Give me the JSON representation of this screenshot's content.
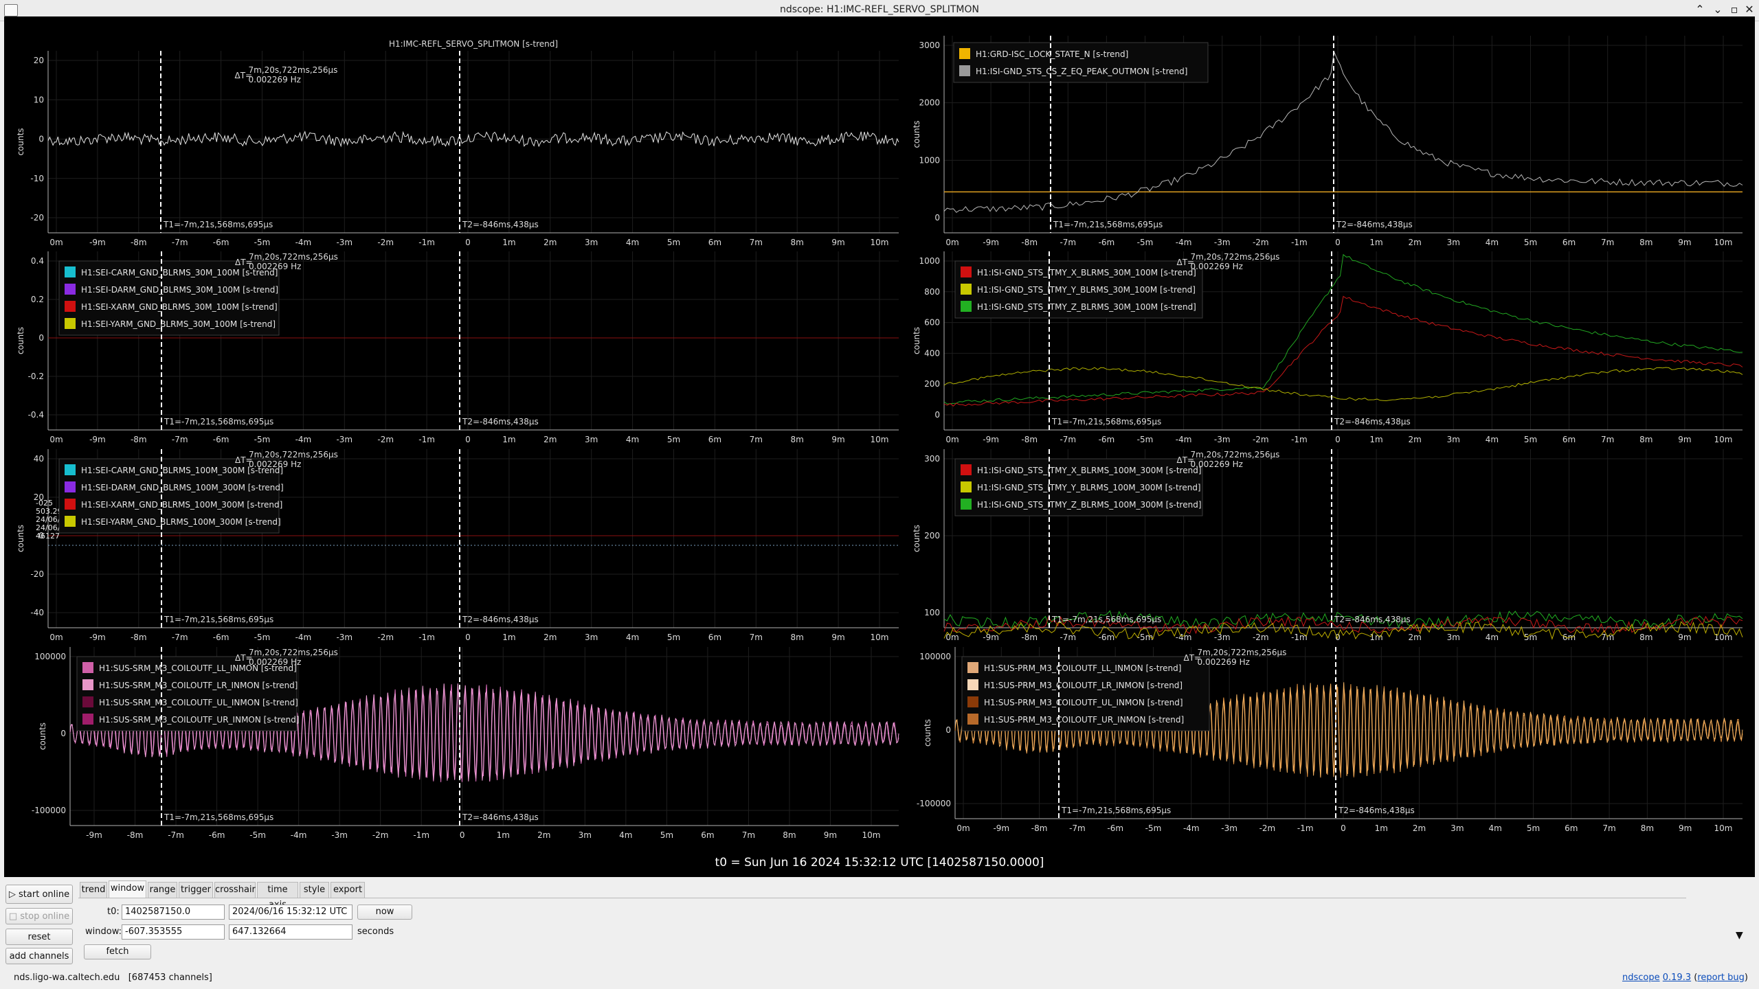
{
  "window": {
    "title": "ndscope: H1:IMC-REFL_SERVO_SPLITMON"
  },
  "t0_text": "t0 = Sun Jun 16 2024 15:32:12 UTC [1402587150.0000]",
  "colors": {
    "background": "#000000",
    "grid": "#1e1e1e",
    "axis": "#b4b4b4",
    "cursor": "#ffffff"
  },
  "cursor_readouts": {
    "t1_label": "T1=-7m,21s,568ms,695µs",
    "t2_label": "T2=-846ms,438µs",
    "delta_t_label": "ΔT=",
    "delta_t_value": "7m,20s,722ms,256µs",
    "delta_f_value": "0.002269 Hz"
  },
  "plots": [
    {
      "y_label": "counts",
      "title": "H1:IMC-REFL_SERVO_SPLITMON [s-trend]",
      "x_ticks": [
        "0m",
        "-9m",
        "-8m",
        "-7m",
        "-6m",
        "-5m",
        "-4m",
        "-3m",
        "-2m",
        "-1m",
        "0",
        "1m",
        "2m",
        "3m",
        "4m",
        "5m",
        "6m",
        "7m",
        "8m",
        "9m",
        "10m"
      ],
      "y_ticks": [
        "20",
        "10",
        "0",
        "-10",
        "-20"
      ],
      "legend": [],
      "series_colors": [
        "#e6e6e6"
      ]
    },
    {
      "y_label": "counts",
      "x_ticks": [
        "0m",
        "-9m",
        "-8m",
        "-7m",
        "-6m",
        "-5m",
        "-4m",
        "-3m",
        "-2m",
        "-1m",
        "0",
        "1m",
        "2m",
        "3m",
        "4m",
        "5m",
        "6m",
        "7m",
        "8m",
        "9m",
        "10m"
      ],
      "y_ticks": [
        "3000",
        "2000",
        "1000",
        "0"
      ],
      "legend": [
        {
          "label": "H1:GRD-ISC_LOCK_STATE_N [s-trend]",
          "color": "#f0b400"
        },
        {
          "label": "H1:ISI-GND_STS_CS_Z_EQ_PEAK_OUTMON [s-trend]",
          "color": "#9a9a9a"
        }
      ],
      "series_colors": [
        "#e0a020",
        "#b8b8b8"
      ]
    },
    {
      "y_label": "counts",
      "x_ticks": [
        "0m",
        "-9m",
        "-8m",
        "-7m",
        "-6m",
        "-5m",
        "-4m",
        "-3m",
        "-2m",
        "-1m",
        "0",
        "1m",
        "2m",
        "3m",
        "4m",
        "5m",
        "6m",
        "7m",
        "8m",
        "9m",
        "10m"
      ],
      "y_ticks": [
        "0.4",
        "0.2",
        "0",
        "-0.2",
        "-0.4"
      ],
      "legend": [
        {
          "label": "H1:SEI-CARM_GND_BLRMS_30M_100M [s-trend]",
          "color": "#17becf"
        },
        {
          "label": "H1:SEI-DARM_GND_BLRMS_30M_100M [s-trend]",
          "color": "#8a2be2"
        },
        {
          "label": "H1:SEI-XARM_GND_BLRMS_30M_100M [s-trend]",
          "color": "#d01010"
        },
        {
          "label": "H1:SEI-YARM_GND_BLRMS_30M_100M [s-trend]",
          "color": "#c8c800"
        }
      ],
      "series_colors": [
        "#8b1010"
      ]
    },
    {
      "y_label": "counts",
      "x_ticks": [
        "0m",
        "-9m",
        "-8m",
        "-7m",
        "-6m",
        "-5m",
        "-4m",
        "-3m",
        "-2m",
        "-1m",
        "0",
        "1m",
        "2m",
        "3m",
        "4m",
        "5m",
        "6m",
        "7m",
        "8m",
        "9m",
        "10m"
      ],
      "y_ticks": [
        "1000",
        "800",
        "600",
        "400",
        "200",
        "0"
      ],
      "legend": [
        {
          "label": "H1:ISI-GND_STS_ITMY_X_BLRMS_30M_100M [s-trend]",
          "color": "#d01010"
        },
        {
          "label": "H1:ISI-GND_STS_ITMY_Y_BLRMS_30M_100M [s-trend]",
          "color": "#c8c800"
        },
        {
          "label": "H1:ISI-GND_STS_ITMY_Z_BLRMS_30M_100M [s-trend]",
          "color": "#22b022"
        }
      ],
      "series_colors": [
        "#c81818",
        "#b0b000",
        "#22a822"
      ]
    },
    {
      "y_label": "counts",
      "x_ticks": [
        "0m",
        "-9m",
        "-8m",
        "-7m",
        "-6m",
        "-5m",
        "-4m",
        "-3m",
        "-2m",
        "-1m",
        "0",
        "1m",
        "2m",
        "3m",
        "4m",
        "5m",
        "6m",
        "7m",
        "8m",
        "9m",
        "10m"
      ],
      "y_ticks": [
        "40",
        "20",
        "0",
        "-20",
        "-40"
      ],
      "legend": [
        {
          "label": "H1:SEI-CARM_GND_BLRMS_100M_300M [s-trend]",
          "color": "#17becf"
        },
        {
          "label": "H1:SEI-DARM_GND_BLRMS_100M_300M [s-trend]",
          "color": "#8a2be2"
        },
        {
          "label": "H1:SEI-XARM_GND_BLRMS_100M_300M [s-trend]",
          "color": "#d01010"
        },
        {
          "label": "H1:SEI-YARM_GND_BLRMS_100M_300M [s-trend]",
          "color": "#c8c800"
        }
      ],
      "series_colors": [
        "#8b1010"
      ],
      "hover": [
        "-025",
        "503.2992116",
        "24/06/16 15:21:25 UTC",
        "24/06/16 08:21:25 PDT",
        "46127"
      ]
    },
    {
      "y_label": "counts",
      "x_ticks": [
        "0m",
        "-9m",
        "-8m",
        "-7m",
        "-6m",
        "-5m",
        "-4m",
        "-3m",
        "-2m",
        "-1m",
        "0",
        "1m",
        "2m",
        "3m",
        "4m",
        "5m",
        "6m",
        "7m",
        "8m",
        "9m",
        "10m"
      ],
      "y_ticks": [
        "300",
        "200",
        "100"
      ],
      "legend": [
        {
          "label": "H1:ISI-GND_STS_ITMY_X_BLRMS_100M_300M [s-trend]",
          "color": "#d01010"
        },
        {
          "label": "H1:ISI-GND_STS_ITMY_Y_BLRMS_100M_300M [s-trend]",
          "color": "#c8c800"
        },
        {
          "label": "H1:ISI-GND_STS_ITMY_Z_BLRMS_100M_300M [s-trend]",
          "color": "#22b022"
        }
      ],
      "series_colors": [
        "#c81818",
        "#c0b000",
        "#22b022"
      ]
    },
    {
      "y_label": "counts",
      "x_ticks": [
        "-9m",
        "-8m",
        "-7m",
        "-6m",
        "-5m",
        "-4m",
        "-3m",
        "-2m",
        "-1m",
        "0",
        "1m",
        "2m",
        "3m",
        "4m",
        "5m",
        "6m",
        "7m",
        "8m",
        "9m",
        "10m"
      ],
      "y_ticks": [
        "100000",
        "0",
        "-100000"
      ],
      "legend": [
        {
          "label": "H1:SUS-SRM_M3_COILOUTF_LL_INMON [s-trend]",
          "color": "#d060a8"
        },
        {
          "label": "H1:SUS-SRM_M3_COILOUTF_LR_INMON [s-trend]",
          "color": "#e896c8"
        },
        {
          "label": "H1:SUS-SRM_M3_COILOUTF_UL_INMON [s-trend]",
          "color": "#6a0a3a"
        },
        {
          "label": "H1:SUS-SRM_M3_COILOUTF_UR_INMON [s-trend]",
          "color": "#a01d6a"
        }
      ],
      "series_colors": [
        "#e070c0",
        "#f0a0d8"
      ]
    },
    {
      "y_label": "counts",
      "x_ticks": [
        "0m",
        "-9m",
        "-8m",
        "-7m",
        "-6m",
        "-5m",
        "-4m",
        "-3m",
        "-2m",
        "-1m",
        "0",
        "1m",
        "2m",
        "3m",
        "4m",
        "5m",
        "6m",
        "7m",
        "8m",
        "9m",
        "10m"
      ],
      "y_ticks": [
        "100000",
        "0",
        "-100000"
      ],
      "legend": [
        {
          "label": "H1:SUS-PRM_M3_COILOUTF_LL_INMON [s-trend]",
          "color": "#e0a878"
        },
        {
          "label": "H1:SUS-PRM_M3_COILOUTF_LR_INMON [s-trend]",
          "color": "#f8d8b8"
        },
        {
          "label": "H1:SUS-PRM_M3_COILOUTF_UL_INMON [s-trend]",
          "color": "#8a3a08"
        },
        {
          "label": "H1:SUS-PRM_M3_COILOUTF_UR_INMON [s-trend]",
          "color": "#b86a2a"
        }
      ],
      "series_colors": [
        "#e09040",
        "#f0b060"
      ]
    }
  ],
  "controls": {
    "start_online": "start online",
    "stop_online": "stop online",
    "reset": "reset",
    "add_channels": "add channels",
    "tabs": [
      "trend",
      "window",
      "range",
      "trigger",
      "crosshair",
      "time axis",
      "style",
      "export"
    ],
    "active_tab": "window",
    "t0_label": "t0:",
    "t0_gps": "1402587150.0",
    "t0_utc": "2024/06/16 15:32:12 UTC",
    "now": "now",
    "window_label": "window:",
    "window_start": "-607.353555",
    "window_end": "647.132664",
    "seconds": "seconds",
    "fetch": "fetch"
  },
  "status": {
    "server": "nds.ligo-wa.caltech.edu",
    "channels": "[687453 channels]",
    "app": "ndscope",
    "version": "0.19.3",
    "report": "report bug"
  }
}
